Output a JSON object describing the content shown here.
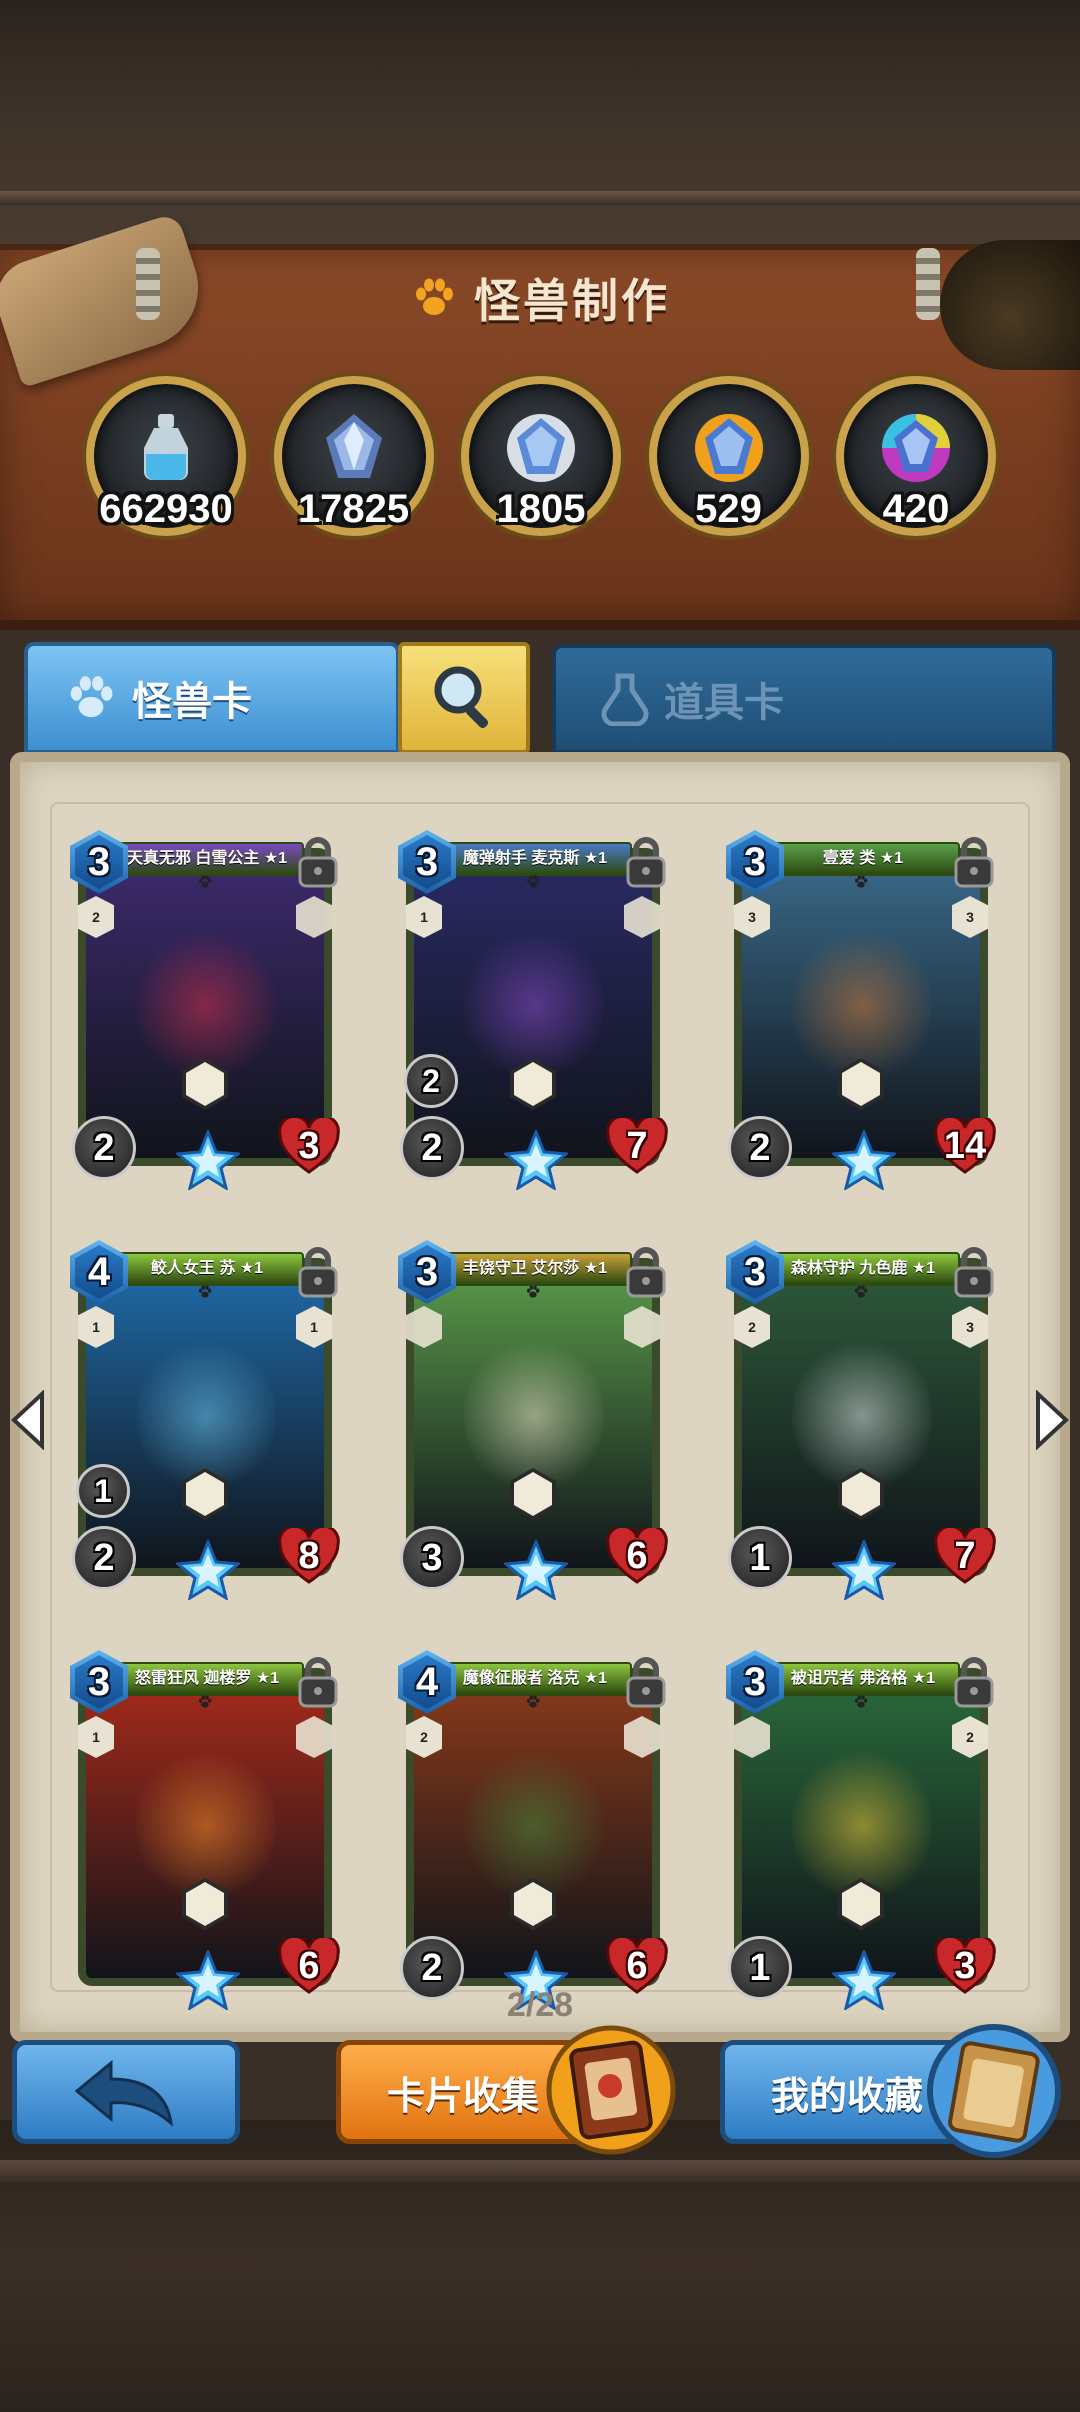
{
  "header": {
    "title": "怪兽制作"
  },
  "resources": [
    {
      "icon": "dust-bottle-icon",
      "count": "662930"
    },
    {
      "icon": "gem-gray-icon",
      "count": "17825"
    },
    {
      "icon": "gem-silver-icon",
      "count": "1805"
    },
    {
      "icon": "gem-gold-icon",
      "count": "529"
    },
    {
      "icon": "gem-rainbow-icon",
      "count": "420"
    }
  ],
  "tabs": {
    "monster": "怪兽卡",
    "items": "道具卡"
  },
  "cards": [
    {
      "name": "天真无邪 白雪公主 ★1",
      "cost": "3",
      "atk": "2",
      "hp": "3",
      "trait_left": "2",
      "trait_right": "",
      "extra": "",
      "frame": "#4a2a7a",
      "art": "#3d2a6e",
      "glow": "#d0304a",
      "bar": "#7a4ac0"
    },
    {
      "name": "魔弹射手 麦克斯 ★1",
      "cost": "3",
      "atk": "2",
      "hp": "7",
      "trait_left": "1",
      "trait_right": "",
      "extra": "2",
      "frame": "#2a3a7a",
      "art": "#2a2a66",
      "glow": "#8a4ac8",
      "bar": "#4a7ac8"
    },
    {
      "name": "壹爱 类 ★1",
      "cost": "3",
      "atk": "2",
      "hp": "14",
      "trait_left": "3",
      "trait_right": "3",
      "extra": "",
      "frame": "#2a5a2a",
      "art": "#3a6a8a",
      "glow": "#c87a3a",
      "bar": "#5aa04a"
    },
    {
      "name": "鲛人女王 苏 ★1",
      "cost": "4",
      "atk": "2",
      "hp": "8",
      "trait_left": "1",
      "trait_right": "1",
      "extra": "1",
      "frame": "#1e5a8a",
      "art": "#1f6aa8",
      "glow": "#6ac0e8",
      "bar": "#8dc63f"
    },
    {
      "name": "丰饶守卫 艾尔莎 ★1",
      "cost": "3",
      "atk": "3",
      "hp": "6",
      "trait_left": "",
      "trait_right": "",
      "extra": "",
      "frame": "#3a6a2a",
      "art": "#5a9a4a",
      "glow": "#e8e0c8",
      "bar": "#c8a03a"
    },
    {
      "name": "森林守护 九色鹿 ★1",
      "cost": "3",
      "atk": "1",
      "hp": "7",
      "trait_left": "2",
      "trait_right": "3",
      "extra": "",
      "frame": "#2a5a2a",
      "art": "#2e5a3a",
      "glow": "#d8e0e0",
      "bar": "#8dc63f"
    },
    {
      "name": "怒雷狂风 迦楼罗 ★1",
      "cost": "3",
      "atk": "",
      "hp": "6",
      "trait_left": "1",
      "trait_right": "",
      "extra": "",
      "frame": "#6a1a1a",
      "art": "#a82a1a",
      "glow": "#f08a2a",
      "bar": "#8dc63f"
    },
    {
      "name": "魔像征服者 洛克 ★1",
      "cost": "4",
      "atk": "2",
      "hp": "6",
      "trait_left": "2",
      "trait_right": "",
      "extra": "",
      "frame": "#5a2a1a",
      "art": "#8a3a1a",
      "glow": "#4a8a3a",
      "bar": "#8dc63f"
    },
    {
      "name": "被诅咒者 弗洛格 ★1",
      "cost": "3",
      "atk": "1",
      "hp": "3",
      "trait_left": "",
      "trait_right": "2",
      "extra": "",
      "frame": "#2a5a2a",
      "art": "#2a6a3a",
      "glow": "#e8c83a",
      "bar": "#8dc63f"
    }
  ],
  "pagination": {
    "text": "2/28"
  },
  "footer": {
    "collect_label": "卡片收集",
    "favorites_label": "我的收藏"
  }
}
